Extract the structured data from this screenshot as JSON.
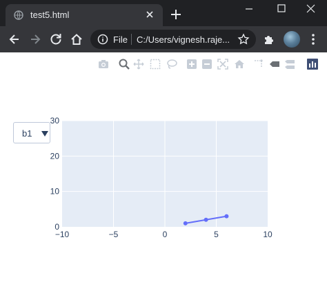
{
  "browser": {
    "tab_title": "test5.html",
    "omnibox": {
      "scheme_label": "File",
      "url": "C:/Users/vignesh.raje..."
    },
    "colors": {
      "titlebar": "#202124",
      "toolbar": "#35363a",
      "text": "#e8eaed"
    },
    "icons": [
      "globe-icon",
      "close-icon",
      "plus-icon",
      "minimize-icon",
      "maximize-icon",
      "close-window-icon",
      "back-icon",
      "forward-icon",
      "reload-icon",
      "home-icon",
      "info-icon",
      "star-icon",
      "puzzle-icon",
      "avatar",
      "more-vert-icon"
    ]
  },
  "modebar": {
    "icons": [
      "camera-icon",
      "zoom-icon",
      "pan-icon",
      "box-select-icon",
      "lasso-select-icon",
      "zoom-in-icon",
      "zoom-out-icon",
      "autoscale-icon",
      "reset-axes-icon",
      "spike-lines-icon",
      "hover-closest-icon",
      "hover-compare-icon",
      "plotly-logo-icon"
    ]
  },
  "dropdown": {
    "selected": "b1"
  },
  "chart_data": {
    "type": "line",
    "title": "",
    "xlabel": "",
    "ylabel": "",
    "xlim": [
      -10,
      10
    ],
    "ylim": [
      0,
      30
    ],
    "x_ticks": [
      -10,
      -5,
      0,
      5,
      10
    ],
    "y_ticks": [
      0,
      10,
      20,
      30
    ],
    "x_tick_labels": [
      "−10",
      "−5",
      "0",
      "5",
      "10"
    ],
    "y_tick_labels": [
      "0",
      "10",
      "20",
      "30"
    ],
    "grid": true,
    "plot_bgcolor": "#e5ecf6",
    "series": [
      {
        "x": [
          2,
          4,
          6
        ],
        "y": [
          1,
          2,
          3
        ],
        "color": "#636efa",
        "mode": "lines+markers"
      }
    ]
  }
}
